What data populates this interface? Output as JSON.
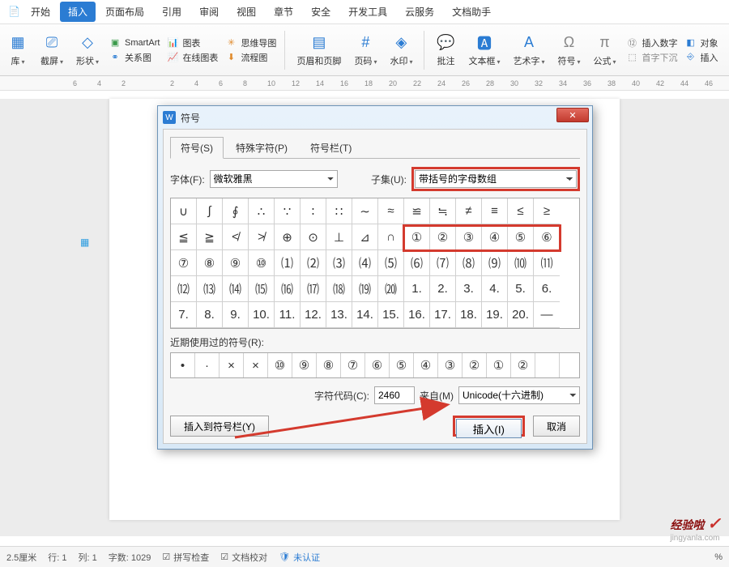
{
  "tabs": {
    "items": [
      "开始",
      "插入",
      "页面布局",
      "引用",
      "审阅",
      "视图",
      "章节",
      "安全",
      "开发工具",
      "云服务",
      "文档助手"
    ],
    "active_index": 1
  },
  "ribbon": {
    "ku": "库",
    "jie": "截屏",
    "xing": "形状",
    "smartart": "SmartArt",
    "guanxi": "关系图",
    "tubiao": "图表",
    "zaixian": "在线图表",
    "siwei": "思维导图",
    "liucheng": "流程图",
    "yemei": "页眉和页脚",
    "yema": "页码",
    "shuiyin": "水印",
    "pizhu": "批注",
    "wenben": "文本框",
    "yishu": "艺术字",
    "fuhao": "符号",
    "gongshi": "公式",
    "charushuzi": "插入数字",
    "shouzi": "首字下沉",
    "duixiang": "对象",
    "charu": "插入"
  },
  "ruler": {
    "marks": [
      "6",
      "4",
      "2",
      "",
      "2",
      "4",
      "6",
      "8",
      "10",
      "12",
      "14",
      "16",
      "18",
      "20",
      "22",
      "24",
      "26",
      "28",
      "30",
      "32",
      "34",
      "36",
      "38",
      "40",
      "42",
      "44",
      "46"
    ]
  },
  "dialog": {
    "title": "符号",
    "tabs": [
      "符号(S)",
      "特殊字符(P)",
      "符号栏(T)"
    ],
    "font_label": "字体(F):",
    "font_value": "微软雅黑",
    "subset_label": "子集(U):",
    "subset_value": "带括号的字母数组",
    "recent_label": "近期使用过的符号(R):",
    "code_label": "字符代码(C):",
    "code_value": "2460",
    "from_label": "来自(M)",
    "from_value": "Unicode(十六进制)",
    "insert_bar_btn": "插入到符号栏(Y)",
    "insert_btn": "插入(I)",
    "cancel_btn": "取消"
  },
  "symbols": {
    "grid": [
      "∪",
      "∫",
      "∮",
      "∴",
      "∵",
      "∶",
      "∷",
      "∼",
      "≈",
      "≌",
      "≒",
      "≠",
      "≡",
      "≤",
      "≥",
      "≦",
      "≧",
      "≮",
      "≯",
      "⊕",
      "⊙",
      "⊥",
      "⊿",
      "∩",
      "①",
      "②",
      "③",
      "④",
      "⑤",
      "⑥",
      "⑦",
      "⑧",
      "⑨",
      "⑩",
      "⑴",
      "⑵",
      "⑶",
      "⑷",
      "⑸",
      "⑹",
      "⑺",
      "⑻",
      "⑼",
      "⑽",
      "⑾",
      "⑿",
      "⒀",
      "⒁",
      "⒂",
      "⒃",
      "⒄",
      "⒅",
      "⒆",
      "⒇",
      "1.",
      "2.",
      "3.",
      "4.",
      "5.",
      "6.",
      "7.",
      "8.",
      "9.",
      "10.",
      "11.",
      "12.",
      "13.",
      "14.",
      "15.",
      "16.",
      "17.",
      "18.",
      "19.",
      "20.",
      "—"
    ],
    "recent": [
      "•",
      "·",
      "×",
      "×",
      "⑩",
      "⑨",
      "⑧",
      "⑦",
      "⑥",
      "⑤",
      "④",
      "③",
      "②",
      "①",
      "②",
      ""
    ]
  },
  "status": {
    "cm": "2.5厘米",
    "row": "行: 1",
    "col": "列: 1",
    "words": "字数: 1029",
    "spell": "拼写检查",
    "proof": "文档校对",
    "auth": "未认证",
    "zoom": "%"
  },
  "watermark": {
    "main": "经验啦",
    "sub": "jingyanla.com"
  }
}
